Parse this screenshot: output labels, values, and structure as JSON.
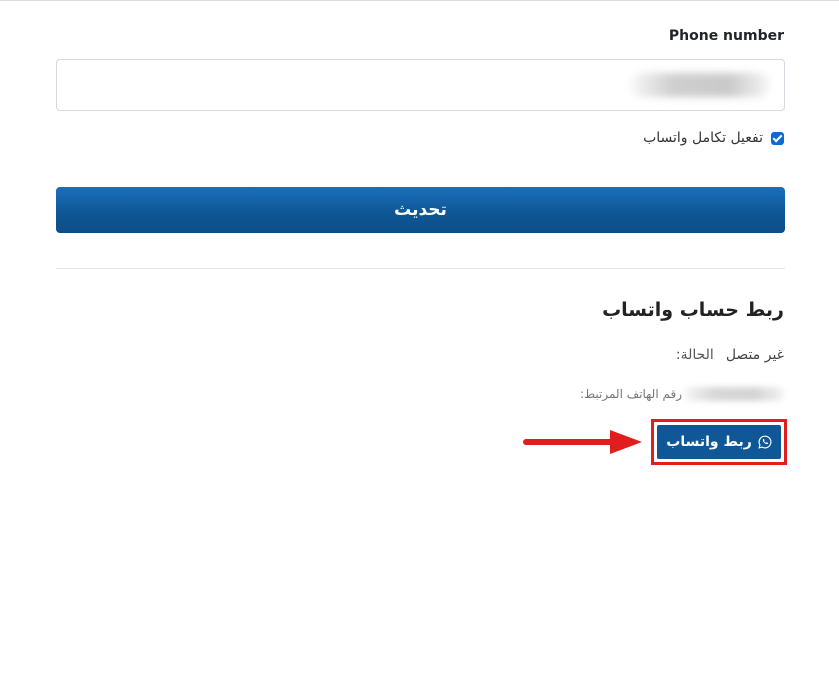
{
  "phone": {
    "label": "Phone number",
    "value": ""
  },
  "integration": {
    "checkbox_label": "تفعيل تكامل واتساب",
    "checked": true
  },
  "update_button": {
    "label": "تحديث"
  },
  "link_section": {
    "title": "ربط حساب واتساب",
    "status_label": "الحالة:",
    "status_value": "غير متصل",
    "linked_phone_label": "رقم الهاتف المرتبط:",
    "link_button_label": "ربط واتساب"
  },
  "colors": {
    "primary": "#0f5796",
    "highlight": "#e01e1e",
    "checkbox": "#0b6bd3"
  },
  "icons": {
    "whatsapp": "whatsapp-icon",
    "arrow": "arrow-right-icon"
  }
}
